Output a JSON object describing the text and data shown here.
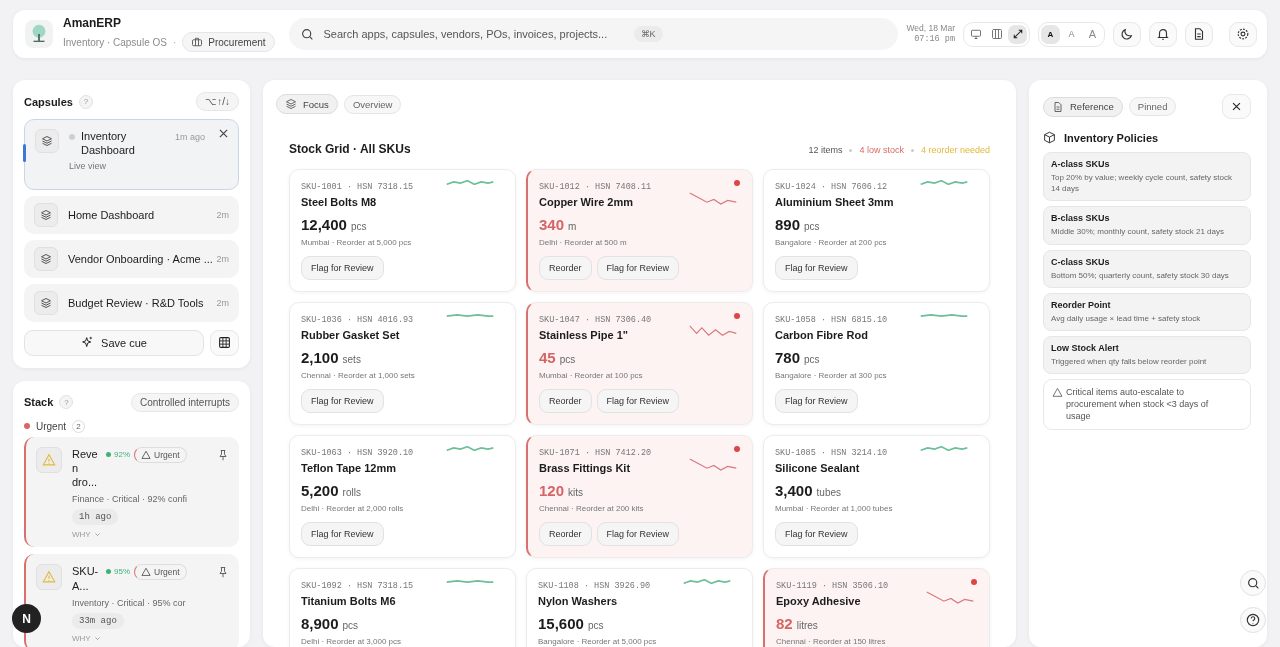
{
  "header": {
    "app_name": "AmanERP",
    "subtitle": "Inventory · Capsule OS",
    "separator": "·",
    "context_chip": "Procurement",
    "search": {
      "placeholder": "Search apps, capsules, vendors, POs, invoices, projects...",
      "shortcut": "⌘K"
    },
    "date": "Wed, 18 Mar",
    "time": "07:16 pm",
    "view_modes": [
      {
        "kind": "desktop",
        "selected": false
      },
      {
        "kind": "columns",
        "selected": false
      },
      {
        "kind": "expand",
        "selected": true
      }
    ],
    "font_sizes": [
      {
        "label": "A",
        "selected": true
      },
      {
        "label": "A",
        "selected": false
      },
      {
        "label": "A",
        "selected": false
      }
    ]
  },
  "capsules": {
    "title": "Capsules",
    "help": "?",
    "shortcut": "⌥↑/↓",
    "items": [
      {
        "title": "Inventory Dashboard",
        "subtitle": "Live view",
        "time": "1m ago",
        "selected": true
      },
      {
        "title": "Home Dashboard",
        "time": "2m",
        "selected": false
      },
      {
        "title": "Vendor Onboarding · Acme ...",
        "time": "2m",
        "selected": false
      },
      {
        "title": "Budget Review · R&D Tools",
        "time": "2m",
        "selected": false
      }
    ],
    "save_button": "Save cue"
  },
  "stack": {
    "title": "Stack",
    "help": "?",
    "mode_chip": "Controlled interrupts",
    "group": {
      "label": "Urgent",
      "count": "2"
    },
    "items": [
      {
        "title": "Reven dro...",
        "confidence": "92%",
        "badge": "Urgent",
        "meta": "Finance · Critical · 92% confi",
        "age": "1h ago",
        "why": "WHY"
      },
      {
        "title": "SKU-A...",
        "confidence": "95%",
        "badge": "Urgent",
        "meta": "Inventory · Critical · 95% cor",
        "age": "33m ago",
        "why": "WHY"
      }
    ]
  },
  "main": {
    "tabs": [
      {
        "label": "Focus",
        "selected": true
      },
      {
        "label": "Overview",
        "selected": false
      }
    ],
    "title": "Stock Grid · All SKUs",
    "stats": [
      {
        "text": "12 items",
        "kind": "neutral"
      },
      {
        "text": "4 low stock",
        "kind": "danger"
      },
      {
        "text": "4 reorder needed",
        "kind": "warning"
      }
    ],
    "cards": [
      {
        "code": "SKU-1001 · HSN 7318.15",
        "name": "Steel Bolts M8",
        "qty": "12,400",
        "unit": "pcs",
        "location": "Mumbai · Reorder at 5,000 pcs",
        "low_stock": false,
        "actions": [
          "Flag for Review"
        ]
      },
      {
        "code": "SKU-1012 · HSN 7408.11",
        "name": "Copper Wire 2mm",
        "qty": "340",
        "unit": "m",
        "location": "Delhi · Reorder at 500 m",
        "low_stock": true,
        "actions": [
          "Reorder",
          "Flag for Review"
        ]
      },
      {
        "code": "SKU-1024 · HSN 7606.12",
        "name": "Aluminium Sheet 3mm",
        "qty": "890",
        "unit": "pcs",
        "location": "Bangalore · Reorder at 200 pcs",
        "low_stock": false,
        "actions": [
          "Flag for Review"
        ]
      },
      {
        "code": "SKU-1036 · HSN 4016.93",
        "name": "Rubber Gasket Set",
        "qty": "2,100",
        "unit": "sets",
        "location": "Chennai · Reorder at 1,000 sets",
        "low_stock": false,
        "actions": [
          "Flag for Review"
        ]
      },
      {
        "code": "SKU-1047 · HSN 7306.40",
        "name": "Stainless Pipe 1\"",
        "qty": "45",
        "unit": "pcs",
        "location": "Mumbai · Reorder at 100 pcs",
        "low_stock": true,
        "actions": [
          "Reorder",
          "Flag for Review"
        ]
      },
      {
        "code": "SKU-1058 · HSN 6815.10",
        "name": "Carbon Fibre Rod",
        "qty": "780",
        "unit": "pcs",
        "location": "Bangalore · Reorder at 300 pcs",
        "low_stock": false,
        "actions": [
          "Flag for Review"
        ]
      },
      {
        "code": "SKU-1063 · HSN 3920.10",
        "name": "Teflon Tape 12mm",
        "qty": "5,200",
        "unit": "rolls",
        "location": "Delhi · Reorder at 2,000 rolls",
        "low_stock": false,
        "actions": [
          "Flag for Review"
        ]
      },
      {
        "code": "SKU-1071 · HSN 7412.20",
        "name": "Brass Fittings Kit",
        "qty": "120",
        "unit": "kits",
        "location": "Chennai · Reorder at 200 kits",
        "low_stock": true,
        "actions": [
          "Reorder",
          "Flag for Review"
        ]
      },
      {
        "code": "SKU-1085 · HSN 3214.10",
        "name": "Silicone Sealant",
        "qty": "3,400",
        "unit": "tubes",
        "location": "Mumbai · Reorder at 1,000 tubes",
        "low_stock": false,
        "actions": [
          "Flag for Review"
        ]
      },
      {
        "code": "SKU-1092 · HSN 7318.15",
        "name": "Titanium Bolts M6",
        "qty": "8,900",
        "unit": "pcs",
        "location": "Delhi · Reorder at 3,000 pcs",
        "low_stock": false
      },
      {
        "code": "SKU-1108 · HSN 3926.90",
        "name": "Nylon Washers",
        "qty": "15,600",
        "unit": "pcs",
        "location": "Bangalore · Reorder at 5,000 pcs",
        "low_stock": false
      },
      {
        "code": "SKU-1119 · HSN 3506.10",
        "name": "Epoxy Adhesive",
        "qty": "82",
        "unit": "litres",
        "location": "Chennai · Reorder at 150 litres",
        "low_stock": true
      }
    ]
  },
  "reference": {
    "tabs": [
      {
        "label": "Reference",
        "selected": true
      },
      {
        "label": "Pinned",
        "selected": false
      }
    ],
    "title": "Inventory Policies",
    "policies": [
      {
        "title": "A-class SKUs",
        "text": "Top 20% by value; weekly cycle count, safety stock 14 days"
      },
      {
        "title": "B-class SKUs",
        "text": "Middle 30%; monthly count, safety stock 21 days"
      },
      {
        "title": "C-class SKUs",
        "text": "Bottom 50%; quarterly count, safety stock 30 days"
      },
      {
        "title": "Reorder Point",
        "text": "Avg daily usage × lead time + safety stock"
      },
      {
        "title": "Low Stock Alert",
        "text": "Triggered when qty falls below reorder point"
      }
    ],
    "note": "Critical items auto-escalate to procurement when stock <3 days of usage"
  },
  "floating": {
    "badge": "N"
  }
}
